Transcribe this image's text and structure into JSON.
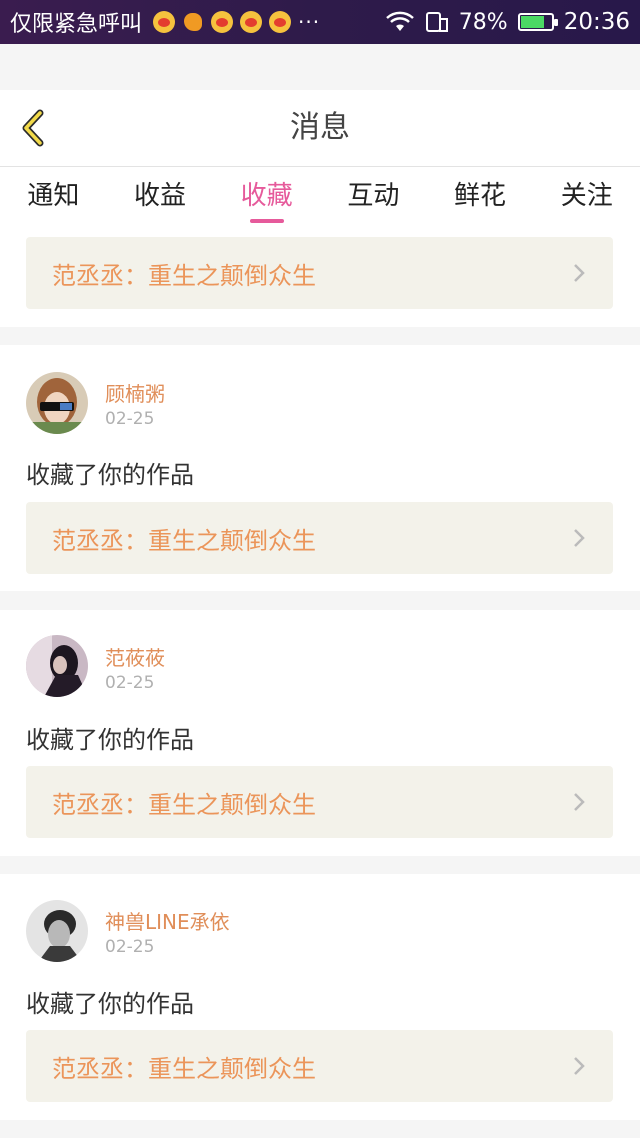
{
  "statusbar": {
    "carrier_text": "仅限紧急呼叫",
    "more": "···",
    "notification_icons": [
      "weibo-icon",
      "uc-squirrel-icon",
      "weibo-icon",
      "weibo-icon",
      "weibo-icon"
    ],
    "battery_percent": "78%",
    "battery_level": 0.78,
    "time": "20:36"
  },
  "header": {
    "title": "消息",
    "back_icon": "chevron-left-icon"
  },
  "tabs": [
    {
      "label": "通知",
      "active": false
    },
    {
      "label": "收益",
      "active": false
    },
    {
      "label": "收藏",
      "active": true
    },
    {
      "label": "互动",
      "active": false
    },
    {
      "label": "鲜花",
      "active": false
    },
    {
      "label": "关注",
      "active": false
    }
  ],
  "top_item": {
    "work_title": "范丞丞：重生之颠倒众生"
  },
  "items": [
    {
      "username": "顾楠粥",
      "date": "02-25",
      "action": "收藏了你的作品",
      "work_title": "范丞丞：重生之颠倒众生"
    },
    {
      "username": "范莜莜",
      "date": "02-25",
      "action": "收藏了你的作品",
      "work_title": "范丞丞：重生之颠倒众生"
    },
    {
      "username": "神兽LINE承依",
      "date": "02-25",
      "action": "收藏了你的作品",
      "work_title": "范丞丞：重生之颠倒众生"
    }
  ],
  "colors": {
    "accent": "#e65a9b",
    "work_text": "#eb955a",
    "username": "#e08e59",
    "work_bg": "#f3f2ea"
  }
}
